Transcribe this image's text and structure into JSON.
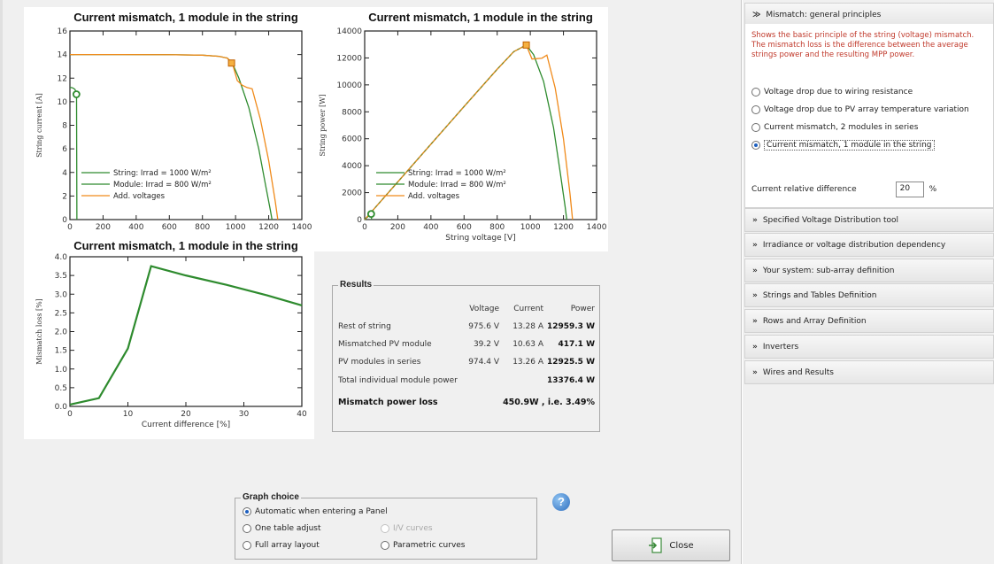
{
  "colors": {
    "green": "#2e8b2e",
    "orange": "#f08a1a",
    "olive": "#8a8a2a",
    "red_text": "#c0392b",
    "accent": "#1d5fbf"
  },
  "chart_data": [
    {
      "type": "line",
      "title": "Current mismatch, 1 module in the string",
      "xlabel": "",
      "ylabel": "String current [A]",
      "xlim": [
        0,
        1400
      ],
      "ylim": [
        0,
        16
      ],
      "xticks": [
        "0",
        "200",
        "400",
        "600",
        "800",
        "1000",
        "1200",
        "1400"
      ],
      "yticks": [
        "0",
        "2",
        "4",
        "6",
        "8",
        "10",
        "12",
        "14",
        "16"
      ],
      "legend": [
        "String: Irrad = 1000 W/m²",
        "Module: Irrad = 800 W/m²",
        "Add. voltages"
      ],
      "legend_position": "bottom-left",
      "series": [
        {
          "name": "String: Irrad = 1000 W/m²",
          "x": [
            0,
            300,
            600,
            800,
            900,
            950,
            980,
            1020,
            1080,
            1140,
            1180,
            1210,
            1220
          ],
          "y": [
            14.0,
            14.0,
            13.99,
            13.95,
            13.85,
            13.7,
            13.28,
            12.0,
            9.5,
            6.0,
            3.0,
            0.8,
            0
          ]
        },
        {
          "name": "Module: Irrad = 800 W/m²",
          "x": [
            0,
            10,
            20,
            30,
            35,
            40,
            42
          ],
          "y": [
            11.2,
            11.2,
            11.15,
            11.05,
            10.9,
            10.63,
            0
          ]
        },
        {
          "name": "Add. voltages",
          "x": [
            0,
            300,
            600,
            800,
            900,
            950,
            980,
            1010,
            1040,
            1070,
            1100,
            1150,
            1200,
            1240,
            1255
          ],
          "y": [
            14.0,
            14.0,
            13.99,
            13.95,
            13.85,
            13.7,
            13.28,
            11.8,
            11.4,
            11.2,
            11.1,
            8.5,
            5.0,
            1.5,
            0
          ]
        }
      ],
      "markers": [
        {
          "x": 975.6,
          "y": 13.28,
          "color": "#f08a1a"
        },
        {
          "x": 39.2,
          "y": 10.63,
          "color": "#2e8b2e"
        }
      ]
    },
    {
      "type": "line",
      "title": "Current mismatch, 1 module in the string",
      "xlabel": "String voltage [V]",
      "ylabel": "String power [W]",
      "xlim": [
        0,
        1400
      ],
      "ylim": [
        0,
        14000
      ],
      "xticks": [
        "0",
        "200",
        "400",
        "600",
        "800",
        "1000",
        "1200",
        "1400"
      ],
      "yticks": [
        "0",
        "2000",
        "4000",
        "6000",
        "8000",
        "10000",
        "12000",
        "14000"
      ],
      "legend": [
        "String: Irrad = 1000 W/m²",
        "Module: Irrad = 800 W/m²",
        "Add. voltages"
      ],
      "legend_position": "bottom-left",
      "series": [
        {
          "name": "String: Irrad = 1000 W/m²",
          "x": [
            0,
            200,
            400,
            600,
            800,
            900,
            975.6,
            1020,
            1080,
            1140,
            1180,
            1210,
            1220
          ],
          "y": [
            0,
            2800,
            5600,
            8390,
            11160,
            12465,
            12959.3,
            12240,
            10260,
            6840,
            3540,
            970,
            0
          ]
        },
        {
          "name": "Module: Irrad = 800 W/m²",
          "x": [
            0,
            20,
            39.2,
            42
          ],
          "y": [
            0,
            220,
            417.1,
            0
          ]
        },
        {
          "name": "Add. voltages",
          "x": [
            0,
            200,
            400,
            600,
            800,
            900,
            975.6,
            1010,
            1070,
            1100,
            1150,
            1200,
            1240,
            1255
          ],
          "y": [
            0,
            2800,
            5600,
            8390,
            11160,
            12465,
            12959.3,
            11920,
            11980,
            12210,
            9780,
            6000,
            1860,
            0
          ]
        }
      ],
      "markers": [
        {
          "x": 975.6,
          "y": 12959.3,
          "color": "#f08a1a"
        },
        {
          "x": 39.2,
          "y": 417.1,
          "color": "#2e8b2e"
        }
      ]
    },
    {
      "type": "line",
      "title": "Current mismatch, 1 module in the string",
      "xlabel": "Current difference [%]",
      "ylabel": "Mismatch loss [%]",
      "xlim": [
        0,
        40
      ],
      "ylim": [
        0,
        4.0
      ],
      "xticks": [
        "0",
        "10",
        "20",
        "30",
        "40"
      ],
      "yticks": [
        "0.0",
        "0.5",
        "1.0",
        "1.5",
        "2.0",
        "2.5",
        "3.0",
        "3.5",
        "4.0"
      ],
      "series": [
        {
          "name": "",
          "x": [
            0,
            5,
            10,
            14,
            20,
            27,
            34,
            40
          ],
          "y": [
            0.05,
            0.22,
            1.55,
            3.75,
            3.5,
            3.25,
            2.97,
            2.7
          ]
        }
      ]
    }
  ],
  "results": {
    "title": "Results",
    "headers": [
      "Voltage",
      "Current",
      "Power"
    ],
    "rows": [
      {
        "label": "Rest of string",
        "voltage": "975.6 V",
        "current": "13.28 A",
        "power": "12959.3 W"
      },
      {
        "label": "Mismatched PV module",
        "voltage": "39.2 V",
        "current": "10.63 A",
        "power": "417.1 W"
      },
      {
        "label": "PV modules in series",
        "voltage": "974.4 V",
        "current": "13.26 A",
        "power": "12925.5 W"
      }
    ],
    "total_label": "Total individual module power",
    "total_value": "13376.4 W",
    "loss_label": "Mismatch power loss",
    "loss_value": "450.9W , i.e. 3.49%"
  },
  "graph_choice": {
    "title": "Graph choice",
    "auto": "Automatic when entering a Panel",
    "one_table": "One table adjust",
    "iv_curves": "I/V curves",
    "full_array": "Full array layout",
    "parametric": "Parametric curves"
  },
  "help": {
    "glyph": "?"
  },
  "close_button": {
    "label": "Close",
    "icon": "exit-door-icon"
  },
  "panel": {
    "active_section": "Mismatch: general principles",
    "description": "Shows the basic principle of the string (voltage) mismatch. The mismatch loss is the difference between the average strings power and the resulting MPP power.",
    "options": [
      "Voltage drop due to wiring resistance",
      "Voltage drop due to PV array temperature variation",
      "Current mismatch, 2 modules in series",
      "Current mismatch, 1 module in the string"
    ],
    "selected_option": 3,
    "diff_label": "Current relative difference",
    "diff_value": "20",
    "diff_unit": "%",
    "sections": [
      "Specified Voltage Distribution tool",
      "Irradiance or voltage distribution dependency",
      "Your system: sub-array definition",
      "Strings and Tables Definition",
      "Rows and Array Definition",
      "Inverters",
      "Wires and Results"
    ],
    "chevron_open": "≫",
    "chevron_closed": "»"
  }
}
